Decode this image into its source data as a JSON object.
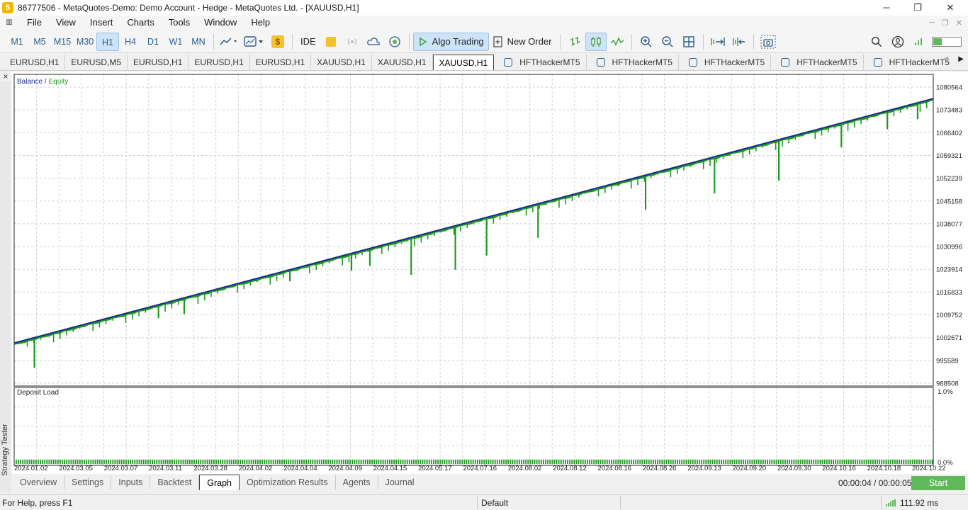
{
  "window": {
    "title": "86777506 - MetaQuotes-Demo: Demo Account - Hedge - MetaQuotes Ltd. - [XAUUSD,H1]",
    "controls": [
      "─",
      "❐",
      "✕"
    ]
  },
  "menu": {
    "items": [
      "File",
      "View",
      "Insert",
      "Charts",
      "Tools",
      "Window",
      "Help"
    ]
  },
  "toolbar": {
    "timeframes": [
      "M1",
      "M5",
      "M15",
      "M30",
      "H1",
      "H4",
      "D1",
      "W1",
      "MN"
    ],
    "active_timeframe": "H1",
    "ide_label": "IDE",
    "algo_label": "Algo Trading",
    "new_order_label": "New Order"
  },
  "chart_tabs": [
    "EURUSD,H1",
    "EURUSD,M5",
    "EURUSD,H1",
    "EURUSD,H1",
    "EURUSD,H1",
    "XAUUSD,H1",
    "XAUUSD,H1",
    "XAUUSD,H1",
    "HFTHackerMT5",
    "HFTHackerMT5",
    "HFTHackerMT5",
    "HFTHackerMT5",
    "HFTHackerMT5"
  ],
  "active_chart_tab": 7,
  "sidebar": {
    "close": "×",
    "label": "Strategy Tester"
  },
  "colors": {
    "balance": "#1b2a8c",
    "equity": "#1d9a1d",
    "grid": "#cfcfcf",
    "accent": "#5fb85a"
  },
  "chart_data": [
    {
      "type": "line",
      "legend": [
        "Balance",
        "Equity"
      ],
      "series": [
        {
          "name": "Balance",
          "x": [
            0,
            1
          ],
          "values": [
            1001000,
            1077000
          ]
        },
        {
          "name": "Equity",
          "drops": [
            {
              "x": 0.022,
              "to": 993300
            },
            {
              "x": 0.157,
              "to": 1008700
            },
            {
              "x": 0.185,
              "to": 1010000
            },
            {
              "x": 0.3,
              "to": 1020200
            },
            {
              "x": 0.367,
              "to": 1023500
            },
            {
              "x": 0.387,
              "to": 1025000
            },
            {
              "x": 0.432,
              "to": 1022200
            },
            {
              "x": 0.48,
              "to": 1023800
            },
            {
              "x": 0.514,
              "to": 1028200
            },
            {
              "x": 0.57,
              "to": 1033700
            },
            {
              "x": 0.687,
              "to": 1042500
            },
            {
              "x": 0.762,
              "to": 1047500
            },
            {
              "x": 0.832,
              "to": 1051500
            },
            {
              "x": 0.9,
              "to": 1061800
            },
            {
              "x": 0.95,
              "to": 1067500
            },
            {
              "x": 0.983,
              "to": 1070600
            }
          ]
        }
      ],
      "y_ticks": [
        "1080564",
        "1073483",
        "1066402",
        "1059321",
        "1052239",
        "1045158",
        "1038077",
        "1030996",
        "1023914",
        "1016833",
        "1009752",
        "1002671",
        "995589",
        "988508"
      ],
      "ylim": [
        988508,
        1080564
      ]
    },
    {
      "type": "bar",
      "title": "Deposit Load",
      "y_ticks": [
        "1.0%",
        "0.0%"
      ],
      "ylim": [
        0,
        1.0
      ],
      "typical_value": 0.03,
      "x_ticks": [
        "2024.01.02",
        "2024.03.05",
        "2024.03.07",
        "2024.03.11",
        "2024.03.28",
        "2024.04.02",
        "2024.04.04",
        "2024.04.09",
        "2024.04.15",
        "2024.05.17",
        "2024.07.16",
        "2024.08.02",
        "2024.08.12",
        "2024.08.16",
        "2024.08.26",
        "2024.09.13",
        "2024.09.20",
        "2024.09.30",
        "2024.10.16",
        "2024.10.18",
        "2024.10.22"
      ]
    }
  ],
  "bottom_tabs": [
    "Overview",
    "Settings",
    "Inputs",
    "Backtest",
    "Graph",
    "Optimization Results",
    "Agents",
    "Journal"
  ],
  "active_bottom_tab": "Graph",
  "timer": "00:00:04 / 00:00:05",
  "start_label": "Start",
  "status": {
    "help": "For Help, press F1",
    "profile": "Default",
    "ping": "111.92 ms"
  }
}
